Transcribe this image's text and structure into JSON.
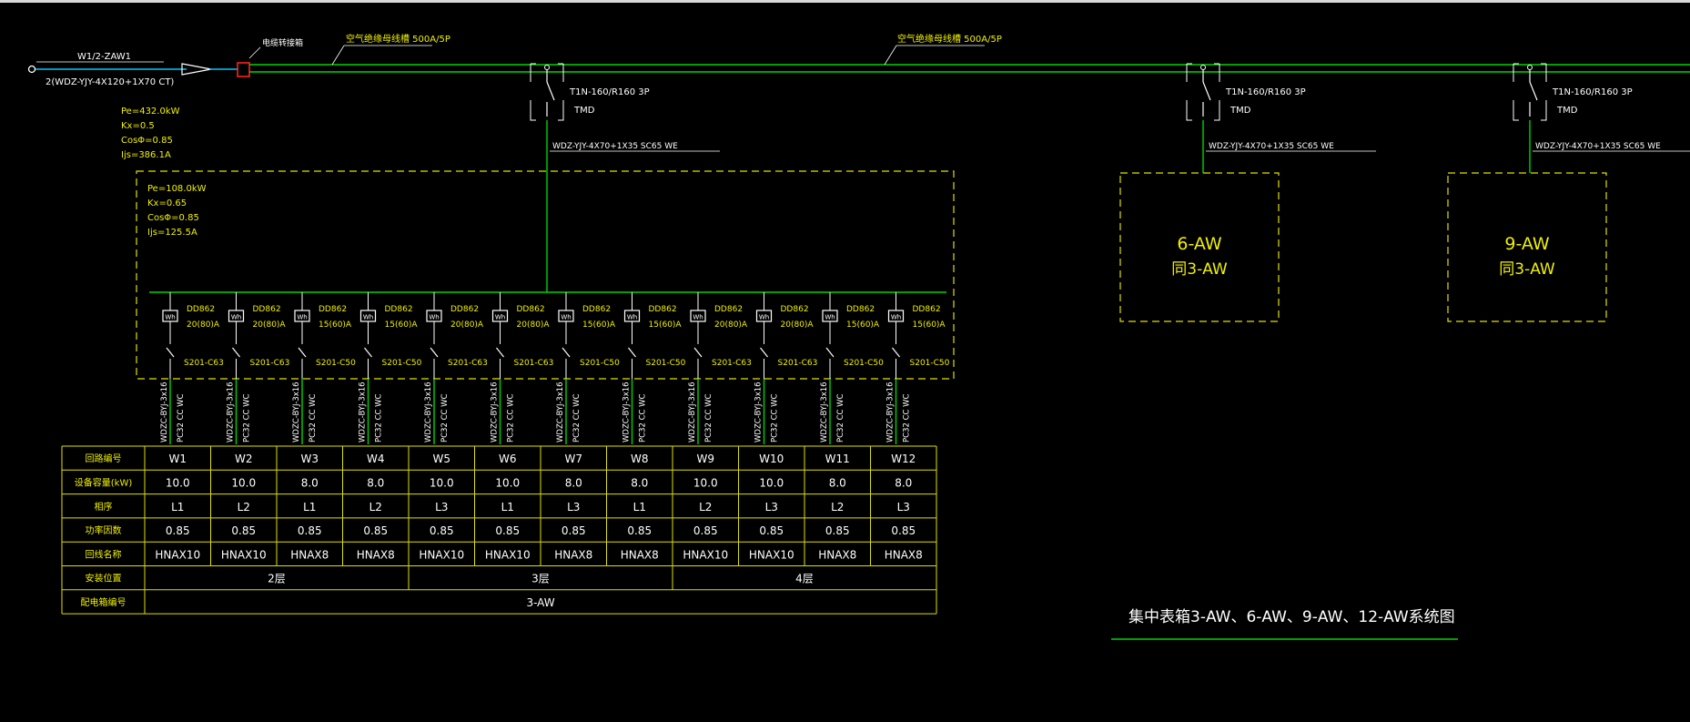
{
  "colors": {
    "background": "#000000",
    "bus": "#00d400",
    "cable": "#00c8ff",
    "frame": "#e0e000",
    "text_white": "#ffffff",
    "text_yellow": "#f0f000",
    "breaker": "#ffffff",
    "marker": "#ff2020"
  },
  "incoming": {
    "feeder": "W1/2-ZAW1",
    "cable": "2(WDZ-YJY-4X120+1X70 CT)",
    "device_label": "电缆转接箱",
    "pe": "Pe=432.0kW",
    "kx": "Kx=0.5",
    "cos": "CosΦ=0.85",
    "ijs": "Ijs=386.1A"
  },
  "busbar": {
    "label_left": "空气绝缘母线槽 500A/5P",
    "label_right": "空气绝缘母线槽 500A/5P"
  },
  "taps": [
    {
      "breaker": "T1N-160/R160 3P",
      "trip": "TMD",
      "cable": "WDZ-YJY-4X70+1X35 SC65 WE"
    },
    {
      "breaker": "T1N-160/R160 3P",
      "trip": "TMD",
      "cable": "WDZ-YJY-4X70+1X35 SC65 WE"
    },
    {
      "breaker": "T1N-160/R160 3P",
      "trip": "TMD",
      "cable": "WDZ-YJY-4X70+1X35 SC65 WE"
    }
  ],
  "box1": {
    "pe": "Pe=108.0kW",
    "kx": "Kx=0.65",
    "cos": "CosΦ=0.85",
    "ijs": "Ijs=125.5A"
  },
  "circuits": [
    {
      "meter_type": "DD862",
      "meter_rating": "20(80)A",
      "breaker": "S201-C63",
      "cable": "WDZC-BYJ-3x16",
      "conduit": "PC32 CC WC"
    },
    {
      "meter_type": "DD862",
      "meter_rating": "20(80)A",
      "breaker": "S201-C63",
      "cable": "WDZC-BYJ-3x16",
      "conduit": "PC32 CC WC"
    },
    {
      "meter_type": "DD862",
      "meter_rating": "15(60)A",
      "breaker": "S201-C50",
      "cable": "WDZC-BYJ-3x16",
      "conduit": "PC32 CC WC"
    },
    {
      "meter_type": "DD862",
      "meter_rating": "15(60)A",
      "breaker": "S201-C50",
      "cable": "WDZC-BYJ-3x16",
      "conduit": "PC32 CC WC"
    },
    {
      "meter_type": "DD862",
      "meter_rating": "20(80)A",
      "breaker": "S201-C63",
      "cable": "WDZC-BYJ-3x16",
      "conduit": "PC32 CC WC"
    },
    {
      "meter_type": "DD862",
      "meter_rating": "20(80)A",
      "breaker": "S201-C63",
      "cable": "WDZC-BYJ-3x16",
      "conduit": "PC32 CC WC"
    },
    {
      "meter_type": "DD862",
      "meter_rating": "15(60)A",
      "breaker": "S201-C50",
      "cable": "WDZC-BYJ-3x16",
      "conduit": "PC32 CC WC"
    },
    {
      "meter_type": "DD862",
      "meter_rating": "15(60)A",
      "breaker": "S201-C50",
      "cable": "WDZC-BYJ-3x16",
      "conduit": "PC32 CC WC"
    },
    {
      "meter_type": "DD862",
      "meter_rating": "20(80)A",
      "breaker": "S201-C63",
      "cable": "WDZC-BYJ-3x16",
      "conduit": "PC32 CC WC"
    },
    {
      "meter_type": "DD862",
      "meter_rating": "20(80)A",
      "breaker": "S201-C63",
      "cable": "WDZC-BYJ-3x16",
      "conduit": "PC32 CC WC"
    },
    {
      "meter_type": "DD862",
      "meter_rating": "15(60)A",
      "breaker": "S201-C50",
      "cable": "WDZC-BYJ-3x16",
      "conduit": "PC32 CC WC"
    },
    {
      "meter_type": "DD862",
      "meter_rating": "15(60)A",
      "breaker": "S201-C50",
      "cable": "WDZC-BYJ-3x16",
      "conduit": "PC32 CC WC"
    }
  ],
  "table": {
    "row_labels": [
      "回路编号",
      "设备容量(kW)",
      "相序",
      "功率因数",
      "回线名称",
      "安装位置",
      "配电箱编号"
    ],
    "circuit_ids": [
      "W1",
      "W2",
      "W3",
      "W4",
      "W5",
      "W6",
      "W7",
      "W8",
      "W9",
      "W10",
      "W11",
      "W12"
    ],
    "capacity": [
      "10.0",
      "10.0",
      "8.0",
      "8.0",
      "10.0",
      "10.0",
      "8.0",
      "8.0",
      "10.0",
      "10.0",
      "8.0",
      "8.0"
    ],
    "phase": [
      "L1",
      "L2",
      "L1",
      "L2",
      "L3",
      "L1",
      "L3",
      "L1",
      "L2",
      "L3",
      "L2",
      "L3"
    ],
    "power_factor": [
      "0.85",
      "0.85",
      "0.85",
      "0.85",
      "0.85",
      "0.85",
      "0.85",
      "0.85",
      "0.85",
      "0.85",
      "0.85",
      "0.85"
    ],
    "line_name": [
      "HNAX10",
      "HNAX10",
      "HNAX8",
      "HNAX8",
      "HNAX10",
      "HNAX10",
      "HNAX8",
      "HNAX8",
      "HNAX10",
      "HNAX10",
      "HNAX8",
      "HNAX8"
    ],
    "floors": [
      "2层",
      "3层",
      "4层"
    ],
    "box_id": "3-AW"
  },
  "box6": {
    "title": "6-AW",
    "note": "同3-AW"
  },
  "box9": {
    "title": "9-AW",
    "note": "同3-AW"
  },
  "drawing_title": "集中表箱3-AW、6-AW、9-AW、12-AW系统图"
}
